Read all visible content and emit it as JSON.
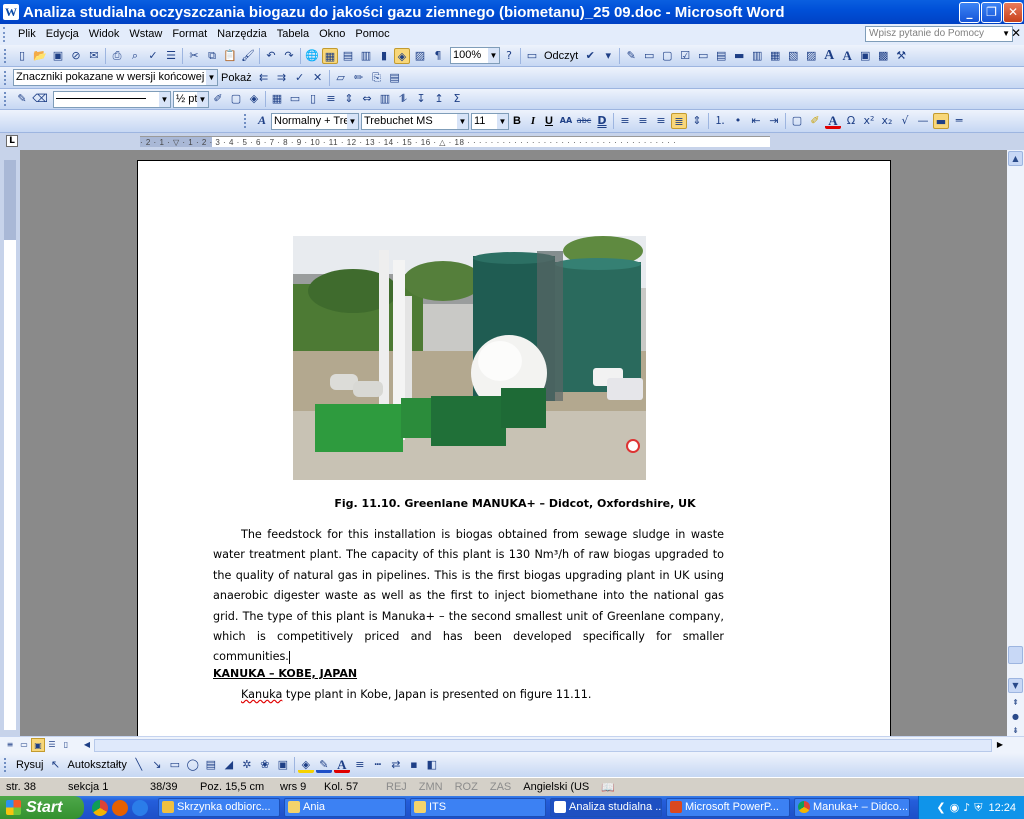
{
  "window": {
    "title": "Analiza studialna oczyszczania biogazu do jakości gazu ziemnego (biometanu)_25 09.doc - Microsoft Word"
  },
  "menu": [
    "Plik",
    "Edycja",
    "Widok",
    "Wstaw",
    "Format",
    "Narzędzia",
    "Tabela",
    "Okno",
    "Pomoc"
  ],
  "help": {
    "placeholder": "Wpisz pytanie do Pomocy"
  },
  "toolbar": {
    "zoom": "100%",
    "read_label": "Odczyt"
  },
  "review_toolbar": {
    "display_mode": "Znaczniki pokazane w wersji końcowej",
    "show_label": "Pokaż"
  },
  "table_toolbar": {
    "line_weight": "½ pt"
  },
  "format_toolbar": {
    "style": "Normalny + Trel",
    "font": "Trebuchet MS",
    "size": "11"
  },
  "document": {
    "caption": "Fig. 11.10. Greenlane MANUKA+ – Didcot, Oxfordshire, UK",
    "paragraph": "The feedstock for this installation is biogas obtained from sewage sludge in waste water treatment plant. The capacity of this plant is 130 Nm³/h of raw biogas upgraded to the quality of natural gas in pipelines. This is the first biogas upgrading plant in UK using anaerobic digester waste as well as the first to inject biomethane into the national gas grid. The type of this plant is Manuka+ – the second smallest unit of Greenlane company, which is competitively priced and has been developed specifically for smaller communities.",
    "heading": "KANUKA – KOBE, JAPAN",
    "para2_word": "Kanuka",
    "para2_rest": " type plant in Kobe, Japan is presented on figure 11.11."
  },
  "drawing": {
    "draw_label": "Rysuj",
    "autoshapes_label": "Autokształty"
  },
  "status": {
    "page": "str. 38",
    "section": "sekcja 1",
    "pages": "38/39",
    "position": "Poz. 15,5 cm",
    "line": "wrs 9",
    "column": "Kol. 57",
    "rec": "REJ",
    "trk": "ZMN",
    "ext": "ROZ",
    "ovr": "ZAS",
    "language": "Angielski (US"
  },
  "taskbar": {
    "start": "Start",
    "tasks": [
      "Skrzynka odbiorc...",
      "Ania",
      "ITS",
      "Analiza studialna ...",
      "Microsoft PowerP...",
      "Manuka+ – Didco..."
    ],
    "clock": "12:24"
  }
}
